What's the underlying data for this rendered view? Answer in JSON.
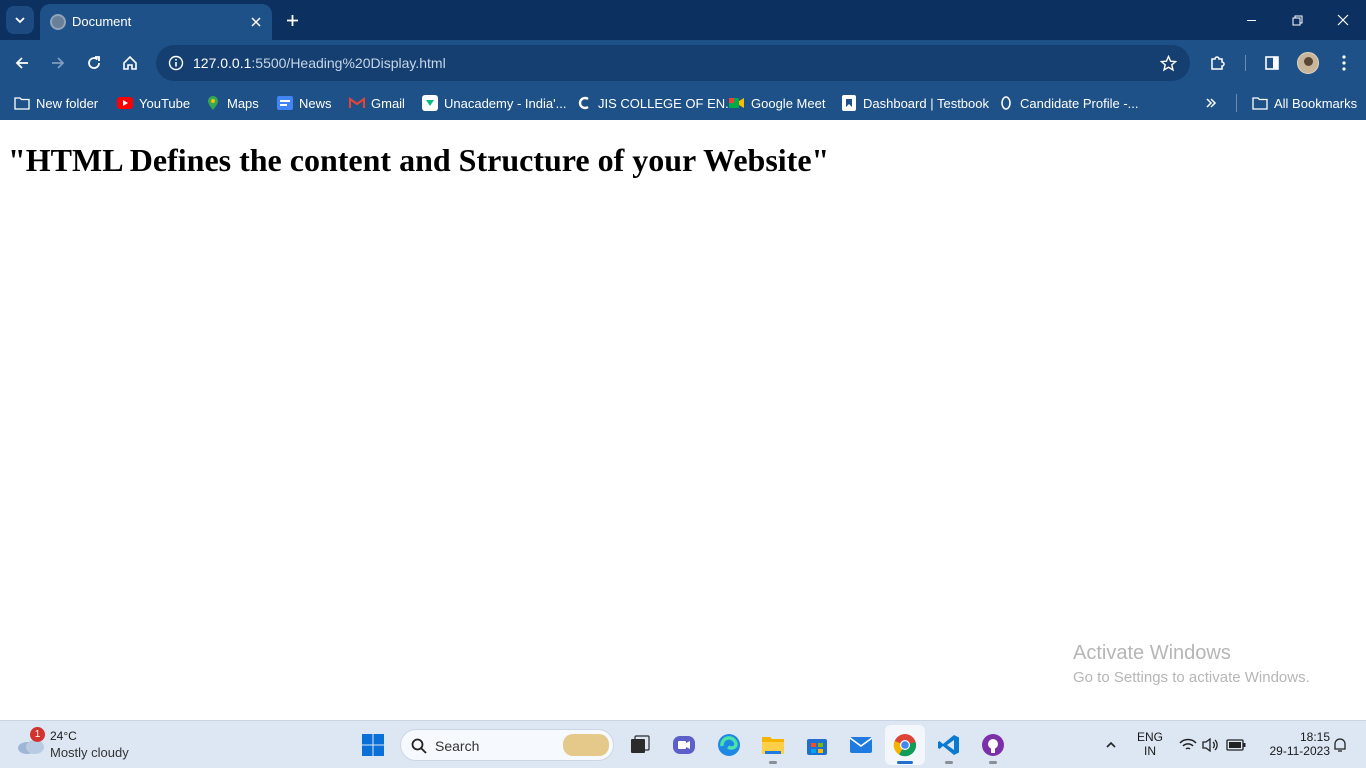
{
  "browser": {
    "tab": {
      "title": "Document"
    },
    "address_bar": {
      "host": "127.0.0.1",
      "path": ":5500/Heading%20Display.html"
    },
    "bookmarks": [
      {
        "label": "New folder"
      },
      {
        "label": "YouTube"
      },
      {
        "label": "Maps"
      },
      {
        "label": "News"
      },
      {
        "label": "Gmail"
      },
      {
        "label": "Unacademy - India'..."
      },
      {
        "label": "JIS COLLEGE OF EN..."
      },
      {
        "label": "Google Meet"
      },
      {
        "label": "Dashboard | Testbook"
      },
      {
        "label": "Candidate Profile -..."
      }
    ],
    "all_bookmarks_label": "All Bookmarks"
  },
  "page": {
    "heading": "\"HTML Defines the content and Structure of your Website\""
  },
  "watermark": {
    "title": "Activate Windows",
    "subtitle": "Go to Settings to activate Windows."
  },
  "taskbar": {
    "weather": {
      "temp": "24°C",
      "condition": "Mostly cloudy",
      "badge": "1"
    },
    "search_placeholder": "Search",
    "language": {
      "line1": "ENG",
      "line2": "IN"
    },
    "clock": {
      "time": "18:15",
      "date": "29-11-2023"
    }
  },
  "colors": {
    "tab_strip": "#0c3060",
    "toolbar": "#1e5187",
    "omnibox": "#143f70",
    "taskbar": "#dde7f3"
  }
}
